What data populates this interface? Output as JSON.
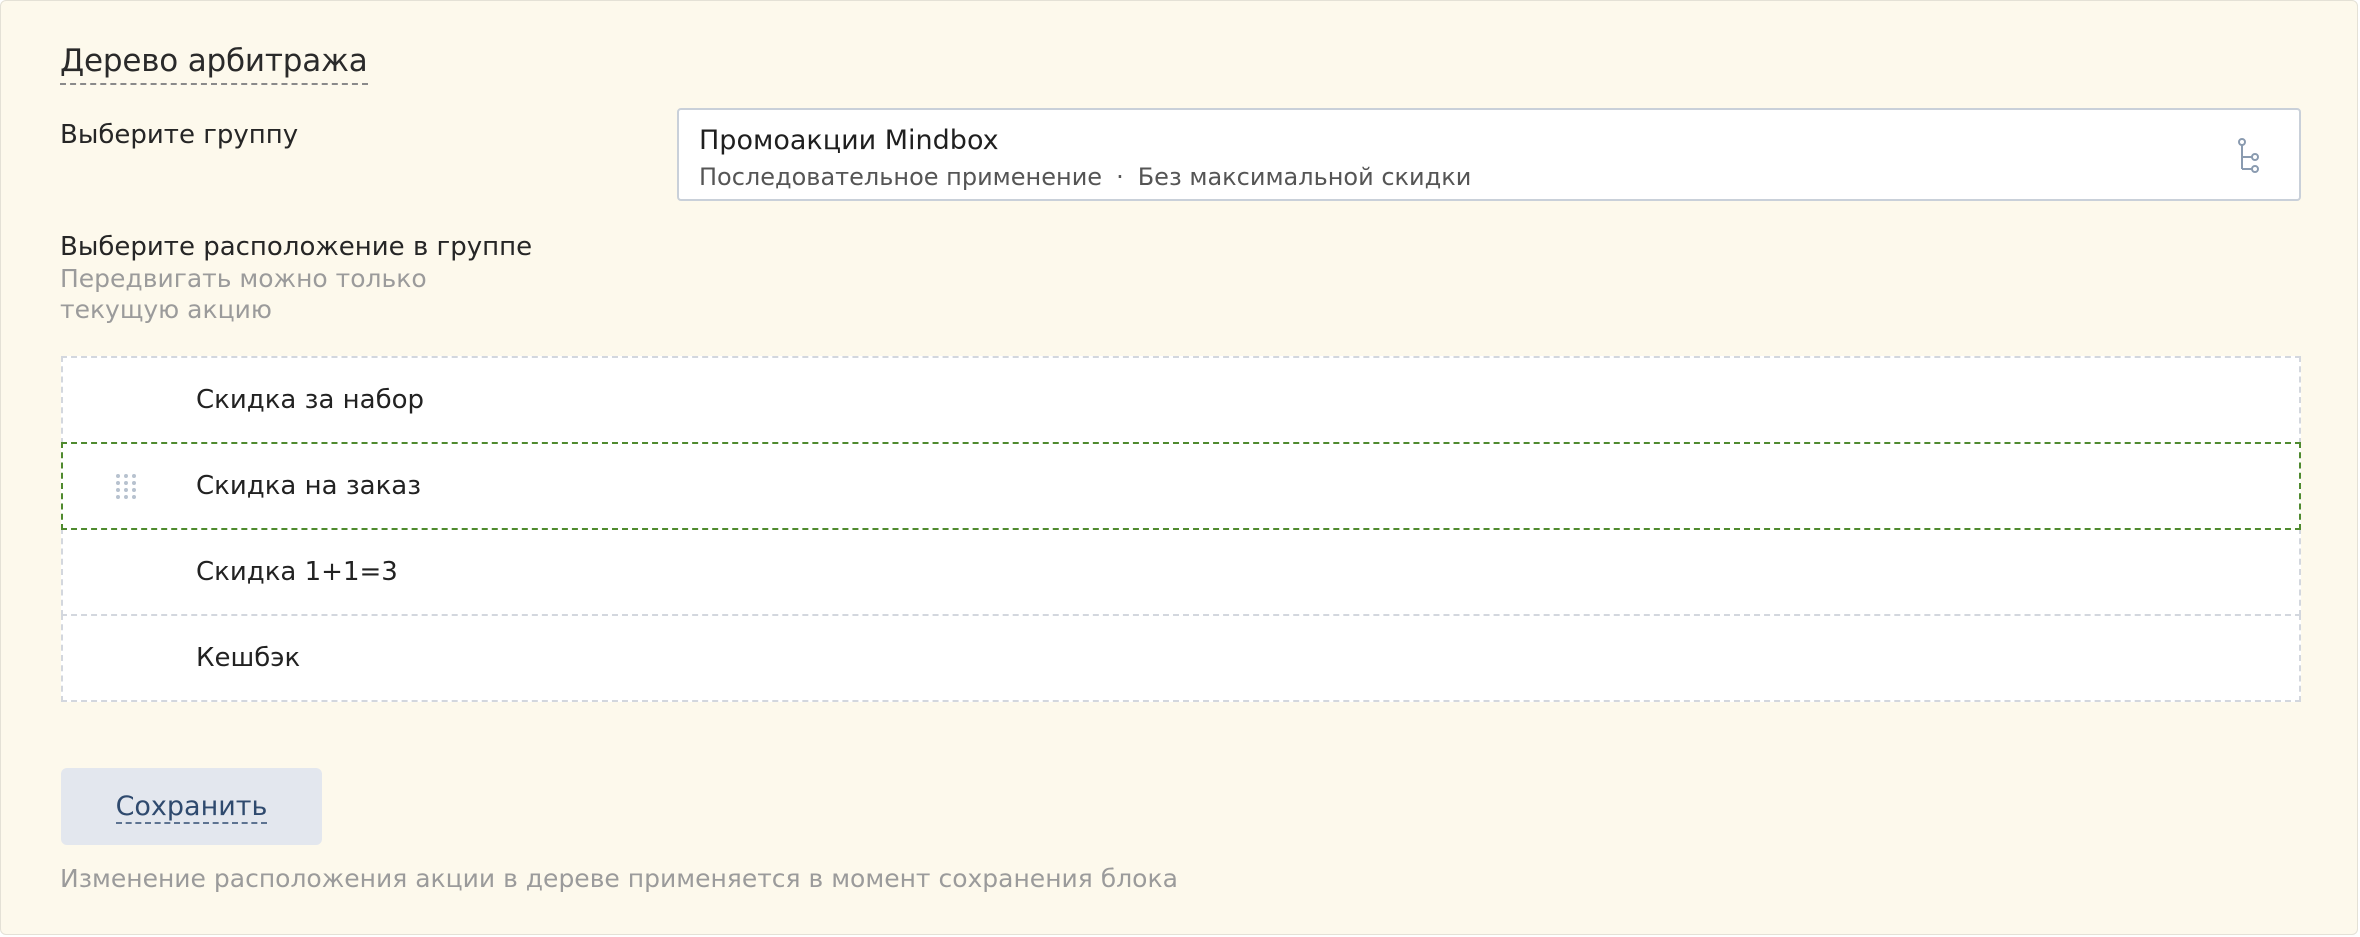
{
  "header": {
    "title": "Дерево арбитража"
  },
  "group": {
    "label": "Выберите группу",
    "selected_name": "Промоакции Mindbox",
    "mode": "Последовательное применение",
    "separator": "·",
    "discount_limit": "Без максимальной скидки",
    "icon": "tree-structure-icon"
  },
  "placement": {
    "label": "Выберите расположение в группе",
    "hint": "Передвигать можно только текущую акцию",
    "items": [
      {
        "label": "Скидка за набор",
        "active": false
      },
      {
        "label": "Скидка на заказ",
        "active": true,
        "handle_icon": "drag-handle-icon"
      },
      {
        "label": "Скидка 1+1=3",
        "active": false
      },
      {
        "label": "Кешбэк",
        "active": false
      }
    ],
    "active_border_color": "#4f8a2f"
  },
  "actions": {
    "save_label": "Сохранить"
  },
  "footer": {
    "note": "Изменение расположения акции в дереве применяется в момент сохранения блока"
  },
  "colors": {
    "panel_background": "#fdf9ec",
    "button_background": "#e3e7ee",
    "button_text": "#2f4a6e",
    "muted_text": "#9b9b9b"
  }
}
